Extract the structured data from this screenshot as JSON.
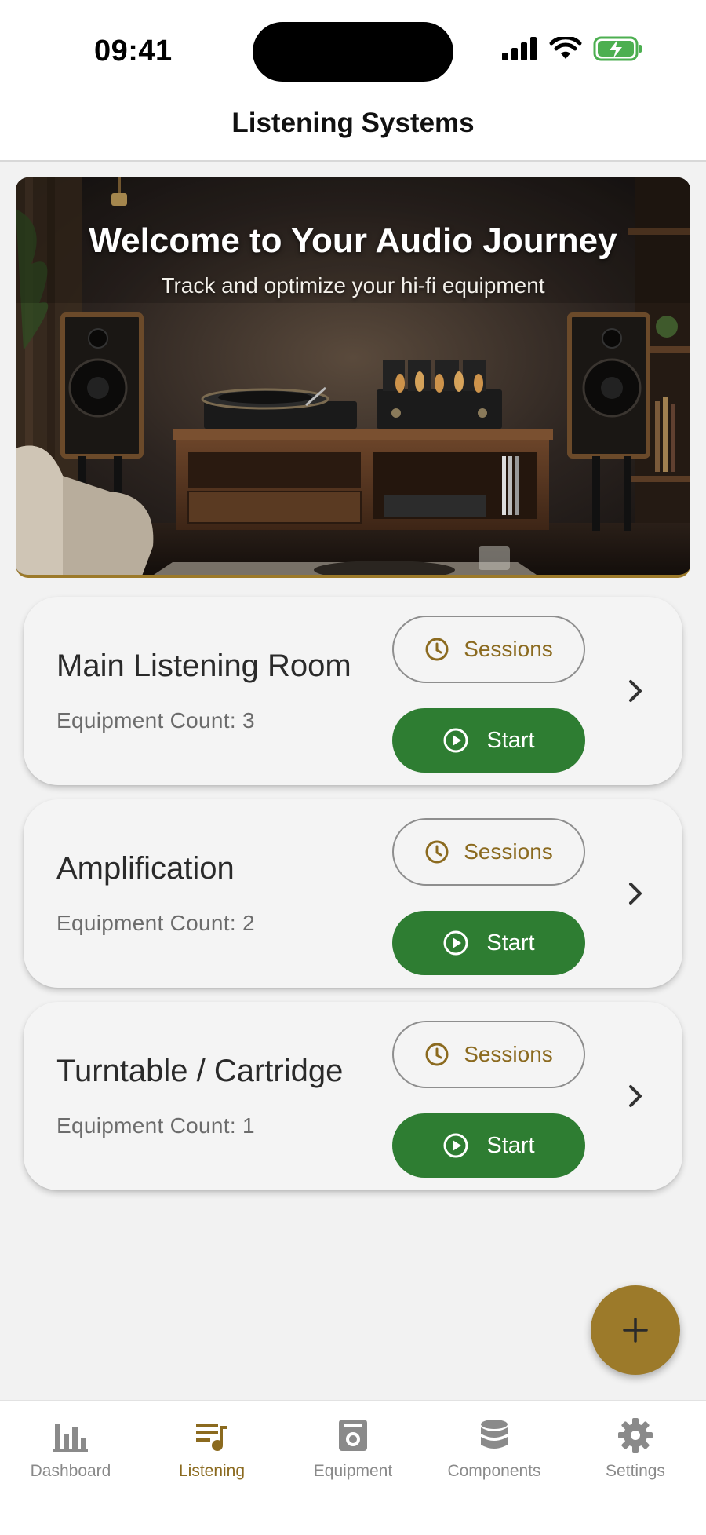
{
  "status_bar": {
    "time": "09:41"
  },
  "header": {
    "title": "Listening Systems"
  },
  "hero": {
    "title": "Welcome to Your Audio Journey",
    "subtitle": "Track and optimize your hi-fi equipment"
  },
  "systems": [
    {
      "name": "Main Listening Room",
      "count_text": "Equipment Count: 3",
      "sessions_label": "Sessions",
      "start_label": "Start"
    },
    {
      "name": "Amplification",
      "count_text": "Equipment Count: 2",
      "sessions_label": "Sessions",
      "start_label": "Start"
    },
    {
      "name": "Turntable / Cartridge",
      "count_text": "Equipment Count: 1",
      "sessions_label": "Sessions",
      "start_label": "Start"
    }
  ],
  "fab": {
    "icon": "plus-icon"
  },
  "nav": {
    "items": [
      {
        "label": "Dashboard",
        "icon": "bar-chart-icon",
        "active": false
      },
      {
        "label": "Listening",
        "icon": "playlist-music-icon",
        "active": true
      },
      {
        "label": "Equipment",
        "icon": "amplifier-icon",
        "active": false
      },
      {
        "label": "Components",
        "icon": "database-icon",
        "active": false
      },
      {
        "label": "Settings",
        "icon": "gear-icon",
        "active": false
      }
    ]
  },
  "colors": {
    "accent_gold": "#9c7a2a",
    "start_green": "#2e7d32",
    "background": "#f2f2f2"
  }
}
